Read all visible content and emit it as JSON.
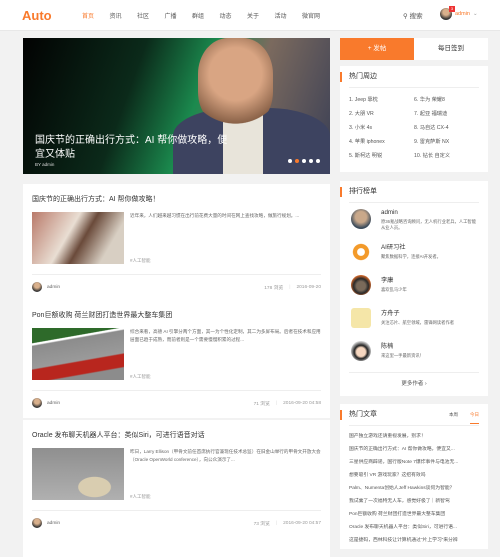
{
  "header": {
    "logo": "Auto",
    "nav": [
      "首页",
      "资讯",
      "社区",
      "广播",
      "群组",
      "动态",
      "关于",
      "活动",
      "微官网"
    ],
    "search": "搜索",
    "user": "admin",
    "badge": "3"
  },
  "banner": {
    "title": "国庆节的正确出行方式：AI 帮你做攻略，便宜又体贴",
    "byline": "BY admin",
    "active_dot": 2,
    "dots": 5
  },
  "articles": [
    {
      "title": "国庆节的正确出行方式：AI 帮你做攻略！",
      "excerpt": "近年来，人们越来越习惯在出行前花费大量的时间在网上查找攻略，做旅行规划。...",
      "tag": "#人工智能",
      "author": "admin",
      "views": "178 浏览",
      "date": "2016-09-20"
    },
    {
      "title": "Pon巨额收购 荷兰财团打造世界最大整车集团",
      "excerpt": "综合来看，高德 AI 引擎分两个方面，其一为个性化定制，其二为多屏布局。后者在技术和应用层面已趋于成熟，而前者则是一个需要慢慢积累的过程...",
      "tag": "#人工智能",
      "author": "admin",
      "views": "71 浏览",
      "date": "2016-09-20 04:58"
    },
    {
      "title": "Oracle 发布聊天机器人平台：类似Siri，可进行语音对话",
      "excerpt": "昨日，Larry Ellison（甲骨文前任首席执行官兼现任技术总监）在旧金山举行的甲骨文开放大会（Oracle OpenWorld conference），向公众演示了...",
      "tag": "#人工智能",
      "author": "admin",
      "views": "73 浏览",
      "date": "2016-09-20 04:57"
    }
  ],
  "sidebar": {
    "post_button": "+ 发帖",
    "checkin_button": "每日签到",
    "hot_title": "热门周边",
    "hot": [
      "1. Jeep 靠枕",
      "6. 华为 荣耀8",
      "2. 大朋 VR",
      "7. 起亚 福瑞迪",
      "3. 小米 4s",
      "8. 马自达 CX-4",
      "4. 苹果 iphonex",
      "9. 雷克萨斯 NX",
      "5. 斯柯达 明锐",
      "10. 钻长 自定义"
    ],
    "rank_title": "排行榜单",
    "ranks": [
      {
        "name": "admin",
        "desc": "原36氪战略咨询顾问，无人机行业老兵，人工智能从业人员。"
      },
      {
        "name": "AI研习社",
        "desc": "聚焦数据科学，连接AI开发者。"
      },
      {
        "name": "李康",
        "desc": "喜欢乱马少年"
      },
      {
        "name": "方舟子",
        "desc": "关注芯片、航空领域，雷锋网读者作者"
      },
      {
        "name": "陈楠",
        "desc": "来这里一手最新资讯！"
      }
    ],
    "more": "更多作者 ›",
    "articles_title": "热门文章",
    "tabs": [
      "本周",
      "今日"
    ],
    "hot_articles": [
      "国产独立游戏还请重视发展，别求！",
      "国庆节的正确出行方式：AI 帮你做攻略，便宜又...",
      "三星供应商辟谣，国行版Note 7爆炸事件与电池无...",
      "想要吸引 VR 游戏玩家？这招有效吗",
      "Palm、Numenta创始人Jeff Hawkins谈何为智能？",
      "我试乘了一次福特无人车，感觉好极了｜新智驾",
      "Pon巨额收购 荷兰财团打造世界最大整车集团",
      "Oracle 发布聊天机器人平台：类似Siri，可进行语...",
      "这是捷码，西林科技让计算机通过“片上学习”来分辨"
    ]
  }
}
